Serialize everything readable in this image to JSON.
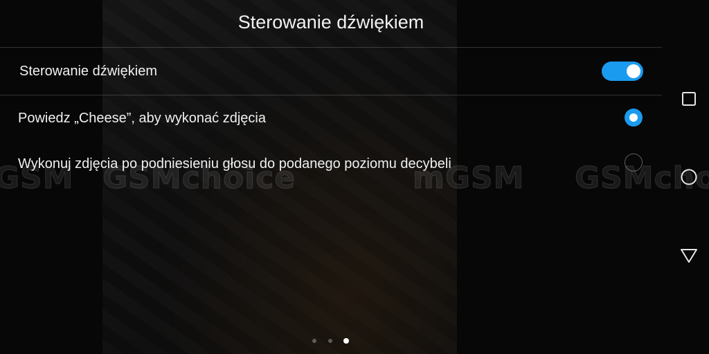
{
  "header": {
    "title": "Sterowanie dźwiękiem"
  },
  "settings": {
    "voice_control": {
      "label": "Sterowanie dźwiękiem",
      "enabled": true
    },
    "options": [
      {
        "label": "Powiedz „Cheese”, aby wykonać zdjęcia",
        "selected": true
      },
      {
        "label": "Wykonuj zdjęcia po podniesieniu głosu do podanego poziomu decybeli",
        "selected": false
      }
    ]
  },
  "watermark": {
    "texts": [
      "GSM",
      "GSMchoice",
      "mGSM",
      "GSMcho"
    ]
  },
  "pagination": {
    "count": 3,
    "active_index": 2
  },
  "nav": {
    "items": [
      "recent-apps-icon",
      "home-icon",
      "back-icon"
    ]
  },
  "colors": {
    "accent": "#1a9bf0",
    "background": "#0b0b0b",
    "text": "#f0f0f0"
  }
}
